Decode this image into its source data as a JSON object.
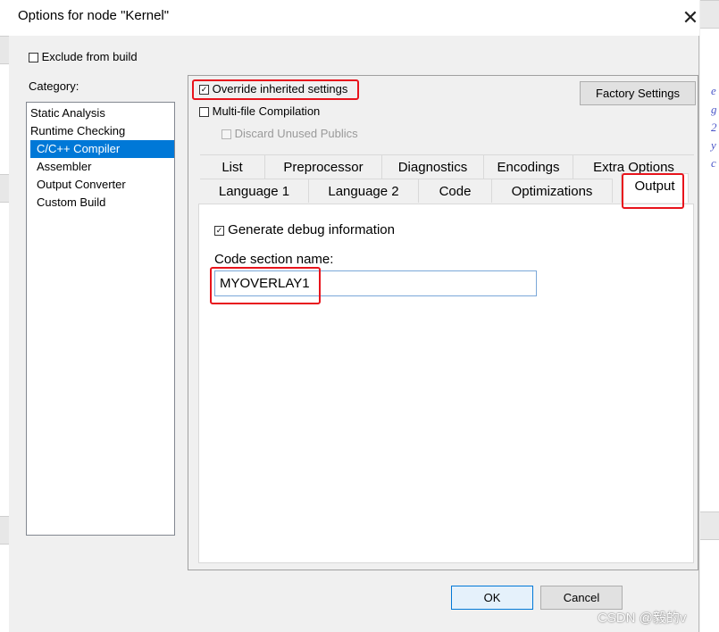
{
  "window": {
    "title": "Options for node \"Kernel\"",
    "close_glyph": "✕"
  },
  "exclude_from_build": {
    "label": "Exclude from build",
    "checked": false
  },
  "category": {
    "label": "Category:",
    "items": [
      "Static Analysis",
      "Runtime Checking",
      "C/C++ Compiler",
      "Assembler",
      "Output Converter",
      "Custom Build"
    ],
    "selected": "C/C++ Compiler"
  },
  "options": {
    "override": {
      "label": "Override inherited settings",
      "checked": true
    },
    "multi_file": {
      "label": "Multi-file Compilation",
      "checked": false
    },
    "discard_unused": {
      "label": "Discard Unused Publics",
      "checked": false,
      "disabled": true
    },
    "factory_settings": "Factory Settings"
  },
  "tabs": {
    "row1": [
      "List",
      "Preprocessor",
      "Diagnostics",
      "Encodings",
      "Extra Options"
    ],
    "row2": [
      "Language 1",
      "Language 2",
      "Code",
      "Optimizations",
      "Output"
    ],
    "active": "Output"
  },
  "output_page": {
    "generate_debug": {
      "label": "Generate debug information",
      "checked": true
    },
    "code_section": {
      "label": "Code section name:",
      "value": "MYOVERLAY1"
    }
  },
  "buttons": {
    "ok": "OK",
    "cancel": "Cancel"
  },
  "background_edge_letters": [
    "e",
    "g",
    "2",
    "y",
    "c"
  ],
  "watermark": "CSDN @毅的v",
  "colors": {
    "selection": "#0078d7",
    "highlight": "#e8141c"
  }
}
